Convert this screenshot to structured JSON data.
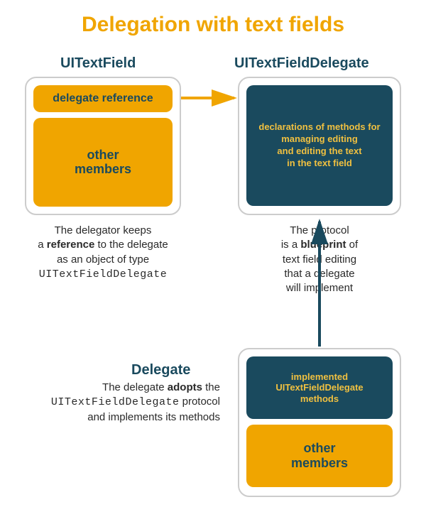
{
  "title": "Delegation with text fields",
  "labels": {
    "textfield": "UITextField",
    "delegateproto": "UITextFieldDelegate",
    "delegate": "Delegate"
  },
  "textfield_box": {
    "delegate_ref": "delegate reference",
    "other_members": "other members"
  },
  "protocol_box": {
    "line1": "declarations of methods for",
    "line2": "managing editing",
    "line3": "and editing the text",
    "line4": "in the text field"
  },
  "delegate_box": {
    "impl_line1": "implemented",
    "impl_line2": "UITextFieldDelegate",
    "impl_line3": "methods",
    "other_members": "other members"
  },
  "captions": {
    "delegator_1": "The delegator keeps",
    "delegator_2a": "a ",
    "delegator_2b": "reference",
    "delegator_2c": " to the delegate",
    "delegator_3": "as an object of type",
    "delegator_4": "UITextFieldDelegate",
    "blueprint_1": "The protocol",
    "blueprint_2a": "is a ",
    "blueprint_2b": "blueprint",
    "blueprint_2c": " of",
    "blueprint_3": "text field editing",
    "blueprint_4": "that a delegate",
    "blueprint_5": "will implement",
    "delegate_1a": "The delegate ",
    "delegate_1b": "adopts",
    "delegate_1c": " the",
    "delegate_2a": "UITextFieldDelegate",
    "delegate_2b": " protocol",
    "delegate_3": "and implements its methods"
  }
}
